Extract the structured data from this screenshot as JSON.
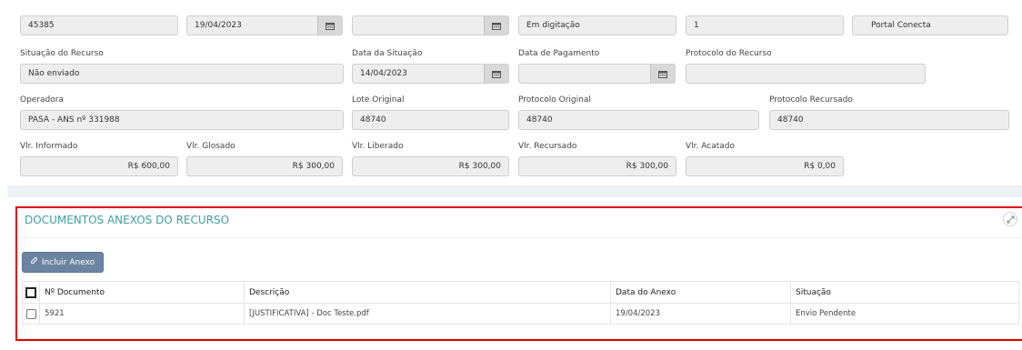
{
  "row1": {
    "numero": "45385",
    "data": "19/04/2023",
    "data_vazia": "",
    "status": "Em digitação",
    "sequencia": "1",
    "origem": "Portal Conecta"
  },
  "labels": {
    "situacao_recurso": "Situação do Recurso",
    "data_situacao": "Data da Situação",
    "data_pagamento": "Data de Pagamento",
    "protocolo_recurso": "Protocolo do Recurso",
    "operadora": "Operadora",
    "lote_original": "Lote Original",
    "protocolo_original": "Protocolo Original",
    "protocolo_recursado": "Protocolo Recursado",
    "vlr_informado": "Vlr. Informado",
    "vlr_glosado": "Vlr. Glosado",
    "vlr_liberado": "Vlr. Liberado",
    "vlr_recursado": "Vlr. Recursado",
    "vlr_acatado": "Vlr. Acatado"
  },
  "values": {
    "situacao_recurso": "Não enviado",
    "data_situacao": "14/04/2023",
    "data_pagamento": "",
    "protocolo_recurso": "",
    "operadora": "PASA - ANS nº 331988",
    "lote_original": "48740",
    "protocolo_original": "48740",
    "protocolo_recursado": "48740",
    "vlr_informado": "R$ 600,00",
    "vlr_glosado": "R$ 300,00",
    "vlr_liberado": "R$ 300,00",
    "vlr_recursado": "R$ 300,00",
    "vlr_acatado": "R$ 0,00"
  },
  "documents": {
    "title": "DOCUMENTOS ANEXOS DO RECURSO",
    "add_button": "Incluir Anexo",
    "columns": {
      "numero": "Nº Documento",
      "descricao": "Descrição",
      "data": "Data do Anexo",
      "situacao": "Situação"
    },
    "rows": [
      {
        "numero": "5921",
        "descricao": "[JUSTIFICATIVA] - Doc Teste.pdf",
        "data": "19/04/2023",
        "situacao": "Envio Pendente"
      }
    ]
  },
  "icons": {
    "calendar": "calendar-icon",
    "paperclip": "paperclip-icon",
    "expand": "expand-icon"
  },
  "colors": {
    "panel_border": "#e60000",
    "title": "#3f9fa0",
    "button": "#6b84a2"
  }
}
